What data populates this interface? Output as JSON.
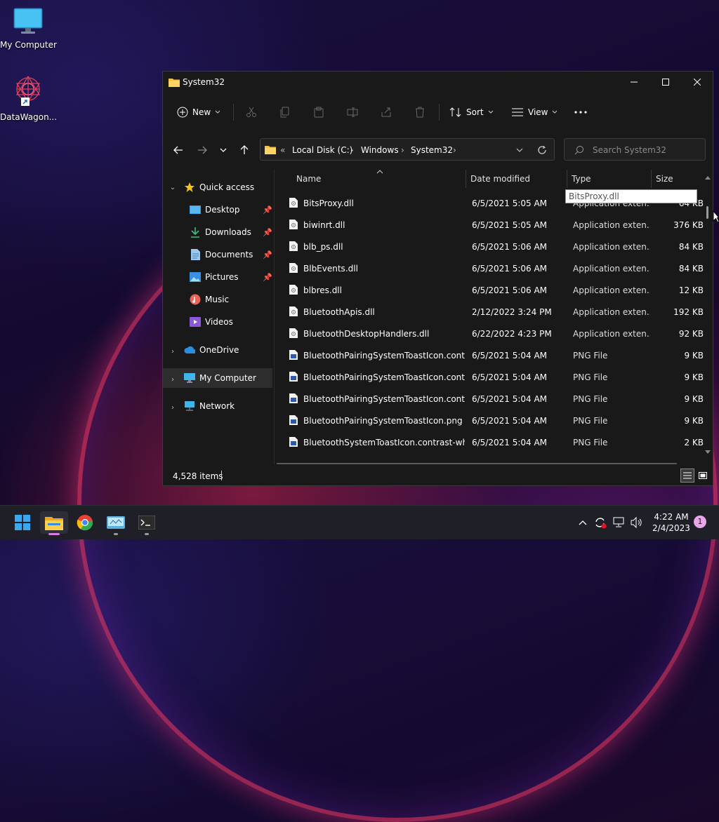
{
  "desktop": {
    "icons": [
      {
        "label": "My Computer",
        "icon": "monitor-icon"
      },
      {
        "label": "DataWagon...",
        "icon": "datawagon-app-icon"
      }
    ]
  },
  "window": {
    "title": "System32",
    "controls": {
      "minimize": "minimize-icon",
      "maximize": "maximize-icon",
      "close": "close-icon"
    }
  },
  "toolbar": {
    "new_label": "New",
    "sort_label": "Sort",
    "view_label": "View",
    "disabled_actions": [
      "cut-icon",
      "copy-icon",
      "paste-icon",
      "rename-icon",
      "share-icon",
      "delete-icon"
    ]
  },
  "address": {
    "crumbs": [
      "Local Disk (C:)",
      "Windows",
      "System32"
    ],
    "overflow": "«"
  },
  "search": {
    "placeholder": "Search System32"
  },
  "sidebar": {
    "quick_access": "Quick access",
    "quick_items": [
      {
        "label": "Desktop",
        "icon": "desktop-folder-icon",
        "pinned": true
      },
      {
        "label": "Downloads",
        "icon": "downloads-icon",
        "pinned": true
      },
      {
        "label": "Documents",
        "icon": "documents-icon",
        "pinned": true
      },
      {
        "label": "Pictures",
        "icon": "pictures-icon",
        "pinned": true
      },
      {
        "label": "Music",
        "icon": "music-icon",
        "pinned": false
      },
      {
        "label": "Videos",
        "icon": "videos-icon",
        "pinned": false
      }
    ],
    "onedrive": "OneDrive",
    "my_computer": "My Computer",
    "network": "Network"
  },
  "columns": {
    "name": "Name",
    "date": "Date modified",
    "type": "Type",
    "size": "Size"
  },
  "tooltip": "BitsProxy.dll",
  "files": [
    {
      "name": "BitsProxy.dll",
      "date": "6/5/2021 5:05 AM",
      "type": "Application exten...",
      "size": "64 KB",
      "kind": "dll"
    },
    {
      "name": "biwinrt.dll",
      "date": "6/5/2021 5:05 AM",
      "type": "Application exten...",
      "size": "376 KB",
      "kind": "dll"
    },
    {
      "name": "blb_ps.dll",
      "date": "6/5/2021 5:06 AM",
      "type": "Application exten...",
      "size": "84 KB",
      "kind": "dll"
    },
    {
      "name": "BlbEvents.dll",
      "date": "6/5/2021 5:06 AM",
      "type": "Application exten...",
      "size": "84 KB",
      "kind": "dll"
    },
    {
      "name": "blbres.dll",
      "date": "6/5/2021 5:06 AM",
      "type": "Application exten...",
      "size": "12 KB",
      "kind": "dll"
    },
    {
      "name": "BluetoothApis.dll",
      "date": "2/12/2022 3:24 PM",
      "type": "Application exten...",
      "size": "192 KB",
      "kind": "dll"
    },
    {
      "name": "BluetoothDesktopHandlers.dll",
      "date": "6/22/2022 4:23 PM",
      "type": "Application exten...",
      "size": "92 KB",
      "kind": "dll"
    },
    {
      "name": "BluetoothPairingSystemToastIcon.contra...",
      "date": "6/5/2021 5:04 AM",
      "type": "PNG File",
      "size": "9 KB",
      "kind": "png"
    },
    {
      "name": "BluetoothPairingSystemToastIcon.contra...",
      "date": "6/5/2021 5:04 AM",
      "type": "PNG File",
      "size": "9 KB",
      "kind": "png"
    },
    {
      "name": "BluetoothPairingSystemToastIcon.contra...",
      "date": "6/5/2021 5:04 AM",
      "type": "PNG File",
      "size": "9 KB",
      "kind": "png"
    },
    {
      "name": "BluetoothPairingSystemToastIcon.png",
      "date": "6/5/2021 5:04 AM",
      "type": "PNG File",
      "size": "9 KB",
      "kind": "png"
    },
    {
      "name": "BluetoothSystemToastIcon.contrast-whit...",
      "date": "6/5/2021 5:04 AM",
      "type": "PNG File",
      "size": "2 KB",
      "kind": "png"
    }
  ],
  "status": {
    "count": "4,528 items"
  },
  "taskbar": {
    "apps": [
      "start-icon",
      "file-explorer-icon",
      "chrome-icon",
      "control-panel-icon",
      "terminal-icon"
    ],
    "time": "4:22 AM",
    "date": "2/4/2023",
    "notifications": "1"
  }
}
